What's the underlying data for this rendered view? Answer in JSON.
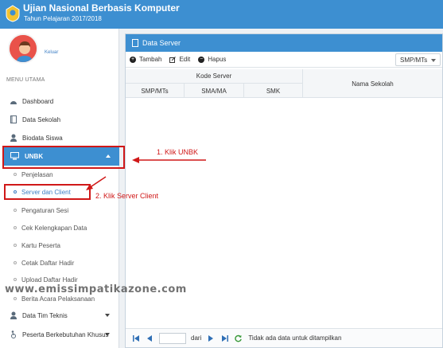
{
  "header": {
    "title": "Ujian Nasional Berbasis Komputer",
    "subtitle": "Tahun Pelajaran 2017/2018",
    "brand_color": "#3d8fd1"
  },
  "user": {
    "logout_label": "Keluar",
    "avatar_icon": "user-avatar-icon"
  },
  "sidebar": {
    "section_label": "MENU UTAMA",
    "items": [
      {
        "label": "Dashboard",
        "icon": "dashboard-icon"
      },
      {
        "label": "Data Sekolah",
        "icon": "book-icon"
      },
      {
        "label": "Biodata Siswa",
        "icon": "user-icon"
      }
    ],
    "unbk": {
      "label": "UNBK",
      "icon": "monitor-icon",
      "children": [
        "Penjelasan",
        "Server dan Client",
        "Pengaturan Sesi",
        "Cek Kelengkapan Data",
        "Kartu Peserta",
        "Cetak Daftar Hadir",
        "Upload Daftar Hadir",
        "Berita Acara Pelaksanaan"
      ],
      "active_child": "Server dan Client"
    },
    "bottom_items": [
      {
        "label": "Data Tim Teknis",
        "icon": "user-icon"
      },
      {
        "label": "Peserta Berkebutuhan Khusus",
        "icon": "wheelchair-icon"
      }
    ]
  },
  "panel": {
    "title": "Data Server",
    "toolbar": {
      "add": "Tambah",
      "edit": "Edit",
      "delete": "Hapus"
    },
    "filter_select": "SMP/MTs",
    "grid": {
      "group_header": "Kode Server",
      "columns": [
        "SMP/MTs",
        "SMA/MA",
        "SMK"
      ],
      "school_column": "Nama Sekolah",
      "rows": []
    },
    "pager": {
      "page_value": "",
      "of_label": "dari",
      "empty_message": "Tidak ada data untuk ditampilkan"
    }
  },
  "annotations": {
    "step1": "1. Klik UNBK",
    "step2": "2. Klik Server Client",
    "color": "#d01818"
  },
  "watermark": "www.emissimpatikazone.com"
}
